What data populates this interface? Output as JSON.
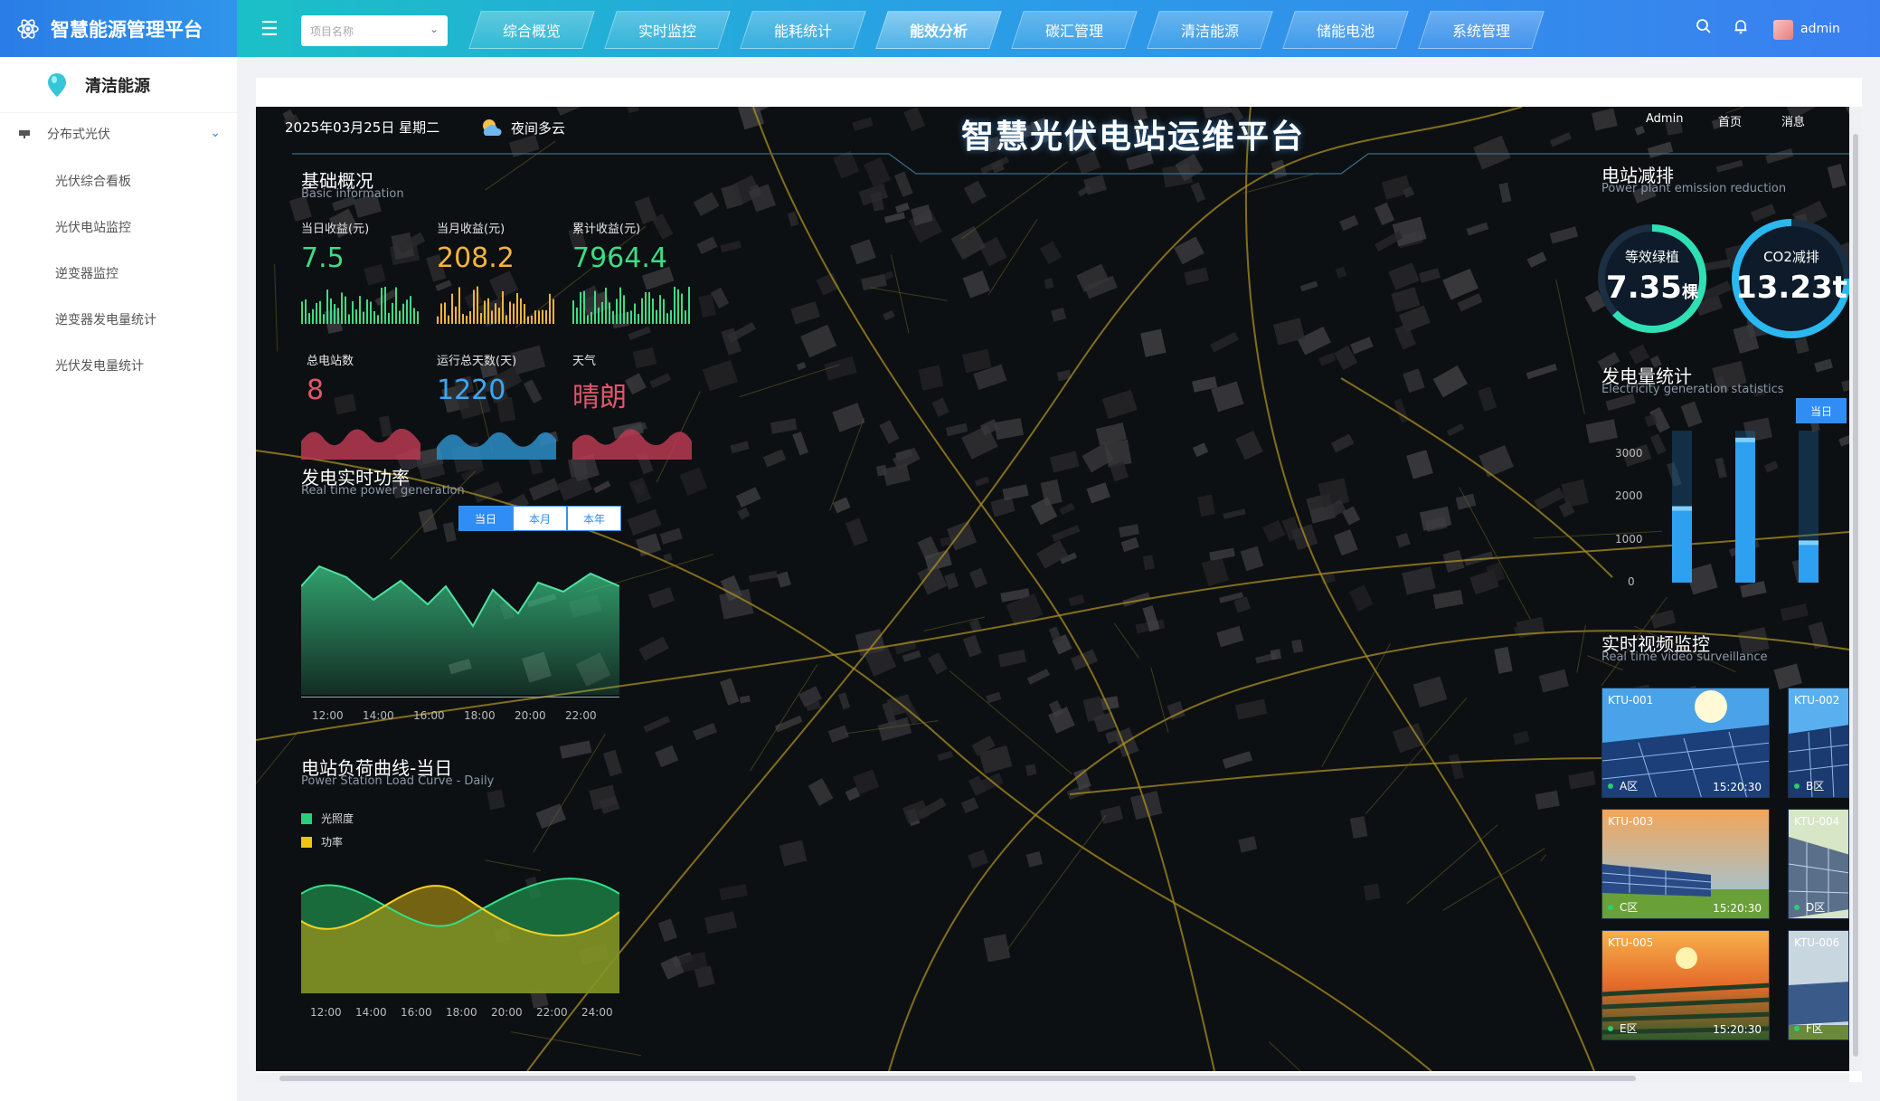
{
  "app": {
    "title": "智慧能源管理平台"
  },
  "sidebar": {
    "title": "清洁能源",
    "group": "分布式光伏",
    "items": [
      {
        "label": "光伏综合看板"
      },
      {
        "label": "光伏电站监控"
      },
      {
        "label": "逆变器监控"
      },
      {
        "label": "逆变器发电量统计"
      },
      {
        "label": "光伏发电量统计"
      }
    ]
  },
  "topbar": {
    "project_placeholder": "项目名称",
    "tabs": [
      {
        "label": "综合概览"
      },
      {
        "label": "实时监控"
      },
      {
        "label": "能耗统计"
      },
      {
        "label": "能效分析"
      },
      {
        "label": "碳汇管理"
      },
      {
        "label": "清洁能源"
      },
      {
        "label": "储能电池"
      },
      {
        "label": "系统管理"
      }
    ],
    "active_tab": "能效分析",
    "username": "admin"
  },
  "screen": {
    "title": "智慧光伏电站运维平台",
    "date": "2025年03月25日 星期二",
    "weather": "夜间多云",
    "links": {
      "admin": "Admin",
      "home": "首页",
      "msg": "消息"
    },
    "basic": {
      "title": "基础概况",
      "subtitle": "Basic information",
      "stats": [
        {
          "label": "当日收益(元)",
          "value": "7.5",
          "color": "#3ddc84"
        },
        {
          "label": "当月收益(元)",
          "value": "208.2",
          "color": "#f5b53a"
        },
        {
          "label": "累计收益(元)",
          "value": "7964.4",
          "color": "#3ddc84"
        },
        {
          "label": "总电站数",
          "value": "8",
          "color": "#e0566a"
        },
        {
          "label": "运行总天数(天)",
          "value": "1220",
          "color": "#39a8f5"
        },
        {
          "label": "天气",
          "value": "晴朗",
          "color": "#e0566a"
        }
      ]
    },
    "power": {
      "title": "发电实时功率",
      "subtitle": "Real time power generation",
      "buttons": [
        "当日",
        "本月",
        "本年"
      ],
      "active": "当日",
      "ticks": [
        "12:00",
        "14:00",
        "16:00",
        "18:00",
        "20:00",
        "22:00"
      ]
    },
    "load": {
      "title": "电站负荷曲线-当日",
      "subtitle": "Power Station Load Curve - Daily",
      "legend": [
        "光照度",
        "功率"
      ],
      "ticks": [
        "12:00",
        "14:00",
        "16:00",
        "18:00",
        "20:00",
        "22:00",
        "24:00"
      ]
    },
    "emission": {
      "title": "电站减排",
      "subtitle": "Power plant emission reduction",
      "items": [
        {
          "label": "等效绿植",
          "value": "7.35",
          "unit": "棵"
        },
        {
          "label": "CO2减排",
          "value": "13.23t",
          "unit": ""
        }
      ]
    },
    "generation": {
      "title": "发电量统计",
      "subtitle": "Electricity generation statistics",
      "button": "当日",
      "yticks": [
        "3000",
        "2000",
        "1000",
        "0"
      ]
    },
    "video": {
      "title": "实时视频监控",
      "subtitle": "Real time video surveillance",
      "cams": [
        {
          "id": "KTU-001",
          "zone": "A区",
          "time": "15:20:30"
        },
        {
          "id": "KTU-002",
          "zone": "B区",
          "time": ""
        },
        {
          "id": "KTU-003",
          "zone": "C区",
          "time": "15:20:30"
        },
        {
          "id": "KTU-004",
          "zone": "D区",
          "time": ""
        },
        {
          "id": "KTU-005",
          "zone": "E区",
          "time": "15:20:30"
        },
        {
          "id": "KTU-006",
          "zone": "F区",
          "time": ""
        }
      ]
    }
  },
  "chart_data": [
    {
      "type": "bar",
      "title": "发电量统计",
      "ylim": [
        0,
        3000
      ],
      "values": [
        1700,
        3300,
        900
      ]
    }
  ]
}
